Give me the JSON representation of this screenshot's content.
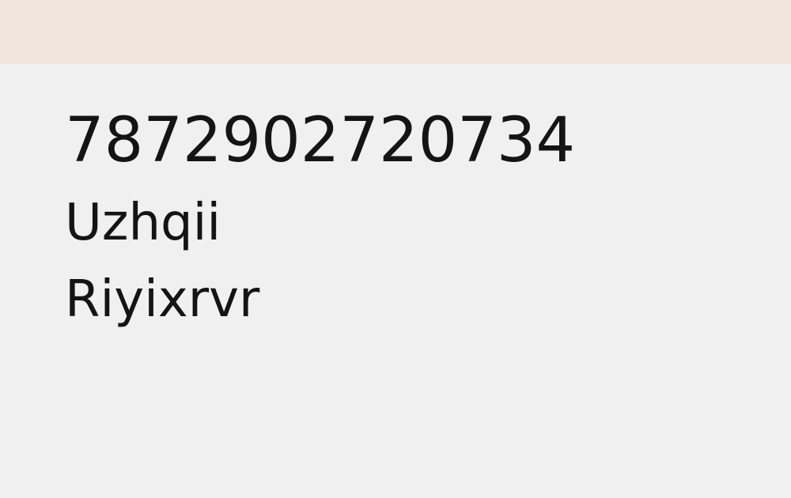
{
  "header": {
    "bar_color": "#f0e6de"
  },
  "main": {
    "background_color": "#f0f0f0",
    "text_color": "#141414",
    "number": "7872902720734",
    "name_primary": "Uzhqii",
    "name_secondary": "Riyixrvr"
  }
}
